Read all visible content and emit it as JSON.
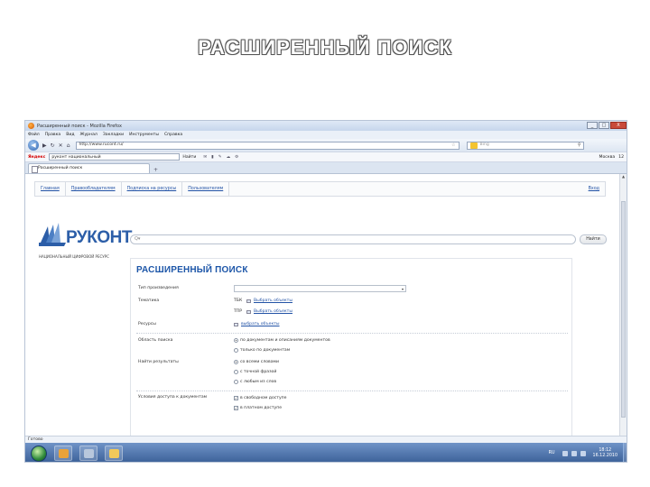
{
  "slide": {
    "title": "РАСШИРЕННЫЙ ПОИСК"
  },
  "browser": {
    "window_title": "Расширенный поиск - Mozilla Firefox",
    "controls": {
      "minimize": "_",
      "maximize": "□",
      "close": "X"
    },
    "menu": [
      "Файл",
      "Правка",
      "Вид",
      "Журнал",
      "Закладки",
      "Инструменты",
      "Справка"
    ],
    "url": "http://www.rucont.ru/",
    "search_placeholder": "Bing",
    "yandex": {
      "logo": "Яндекс",
      "query": "руконт национальный",
      "find_label": "Найти",
      "right_city": "Москва",
      "right_temp": "12"
    },
    "tab": {
      "label": "Расширенный поиск",
      "new_tab": "+"
    },
    "status": "Готово"
  },
  "site": {
    "nav": [
      "Главная",
      "Правообладателям",
      "Подписка на ресурсы",
      "Пользователям"
    ],
    "login": "Вход",
    "logo_word": "РУКОНТ",
    "logo_tagline": "НАЦИОНАЛЬНЫЙ ЦИФРОВОЙ РЕСУРС",
    "search_placeholder": "Q▾",
    "search_button": "Найти"
  },
  "form": {
    "title": "РАСШИРЕННЫЙ ПОИСК",
    "fields": {
      "type_label": "Тип произведения",
      "topic_label": "Тематика",
      "tbk_prefix": "ТБК",
      "tbk_link": "Выбрать объекты",
      "tpp_prefix": "ТПР",
      "tpp_link": "Выбрать объекты",
      "resources_label": "Ресурсы",
      "resources_link": "выбрать объекты",
      "area_label": "Область поиска",
      "area_opt1": "по документам и описаниям документов",
      "area_opt2": "только по документам",
      "find_label": "Найти результаты",
      "find_opt1": "со всеми словами",
      "find_opt2": "с точной фразой",
      "find_opt3": "с любым из слов",
      "access_label": "Условия доступа к документам",
      "access_opt1": "в свободном доступе",
      "access_opt2": "в платном доступе"
    }
  },
  "taskbar": {
    "lang": "RU",
    "time": "18:12",
    "date": "16.12.2010"
  }
}
